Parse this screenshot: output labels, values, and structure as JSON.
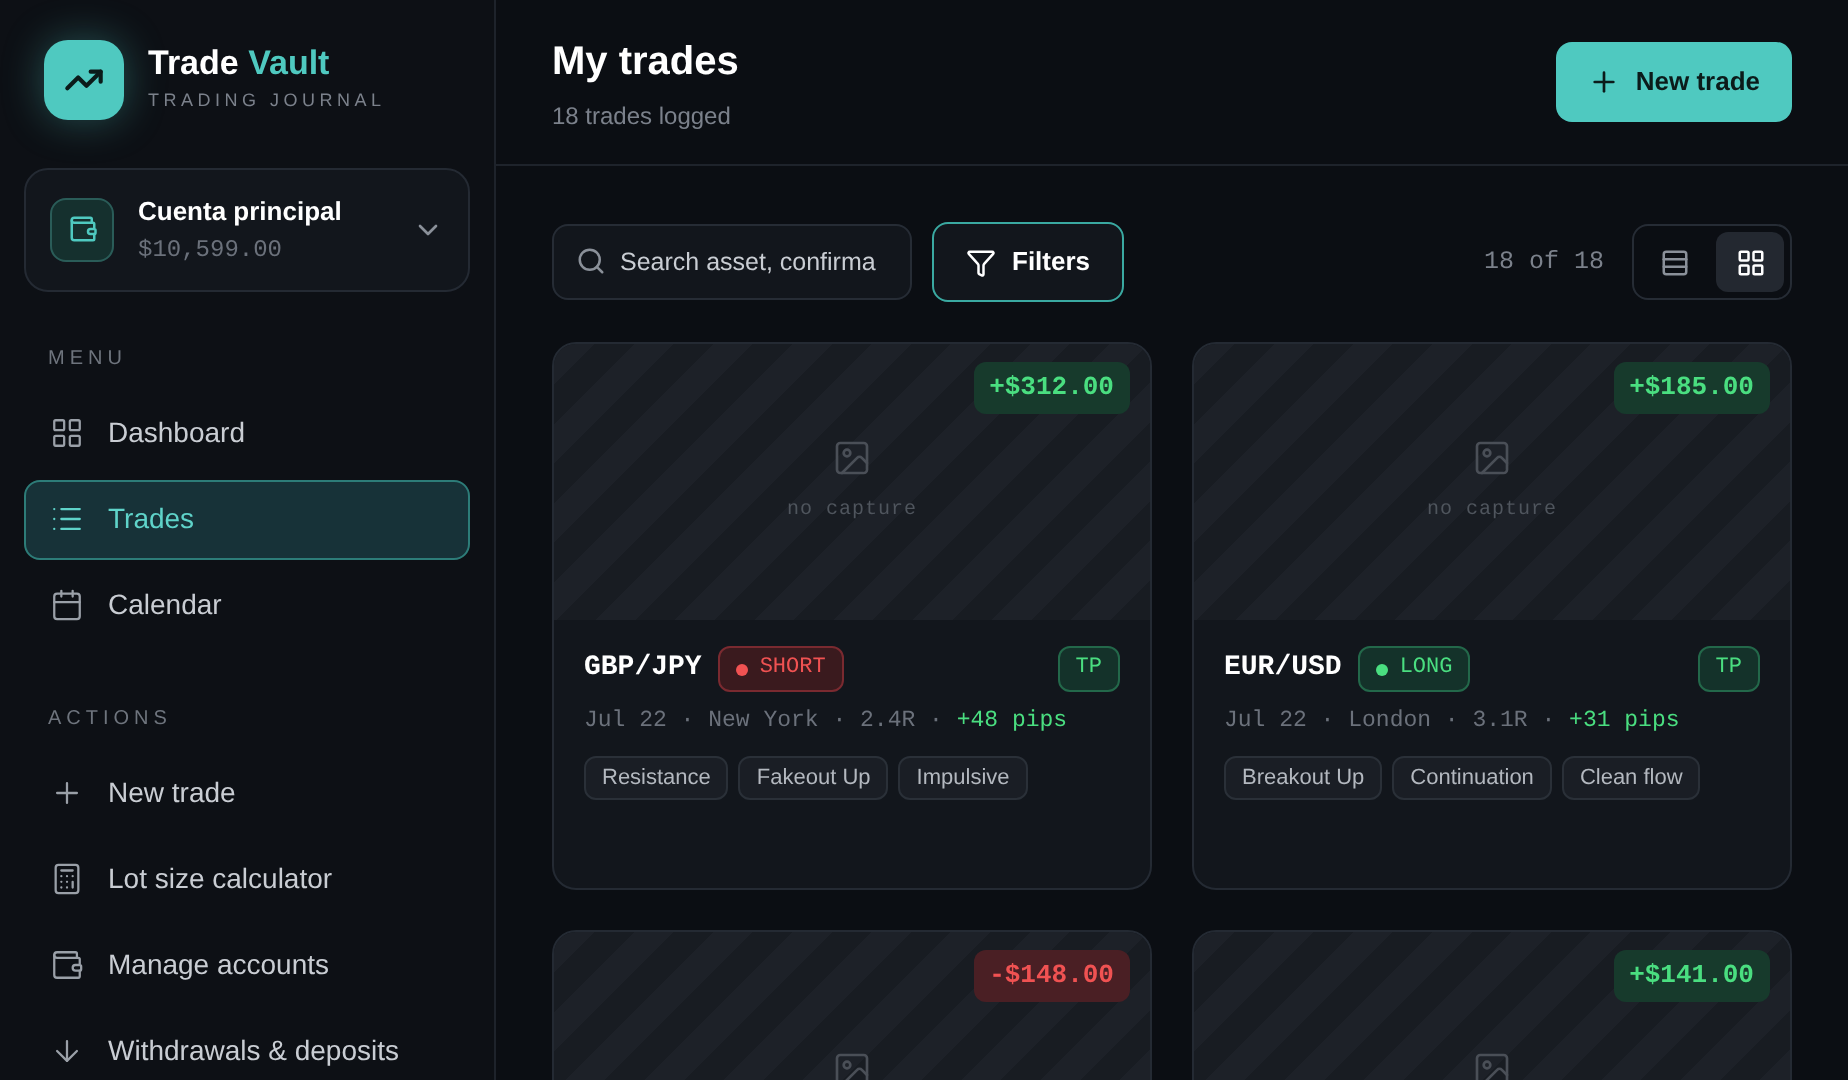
{
  "brand": {
    "name": "Trade ",
    "accent": "Vault",
    "tagline": "TRADING JOURNAL"
  },
  "account": {
    "name": "Cuenta principal",
    "balance": "$10,599.00"
  },
  "sections": [
    {
      "title": "MENU",
      "items": [
        {
          "label": "Dashboard",
          "kind": "dashboard",
          "selected": false
        },
        {
          "label": "Trades",
          "kind": "list",
          "selected": true
        },
        {
          "label": "Calendar",
          "kind": "calendar",
          "selected": false
        }
      ]
    },
    {
      "title": "ACTIONS",
      "items": [
        {
          "label": "New trade",
          "kind": "plus",
          "selected": false
        },
        {
          "label": "Lot size calculator",
          "kind": "calculator",
          "selected": false
        },
        {
          "label": "Manage accounts",
          "kind": "wallet",
          "selected": false
        },
        {
          "label": "Withdrawals & deposits",
          "kind": "arrow-down",
          "selected": false
        }
      ]
    }
  ],
  "header": {
    "title": "My trades",
    "subtitle": "18 trades logged",
    "action": "New trade"
  },
  "search": {
    "placeholder": "Search asset, confirma"
  },
  "filters": "Filters",
  "count": "18 of 18",
  "view_toggle": [
    {
      "kind": "list",
      "selected": false
    },
    {
      "kind": "grid",
      "selected": true
    }
  ],
  "trades": [
    {
      "pnl": "+$312.00",
      "kind": "gain",
      "empty_label": "no capture",
      "pair": "GBP/JPY",
      "side": {
        "label": "SHORT",
        "kind": "short"
      },
      "result": "TP",
      "meta": "Jul 22 · New York · 2.4R ·",
      "pips": "+48 pips",
      "tags": [
        "Resistance",
        "Fakeout Up",
        "Impulsive"
      ]
    },
    {
      "pnl": "+$185.00",
      "kind": "gain",
      "empty_label": "no capture",
      "pair": "EUR/USD",
      "side": {
        "label": "LONG",
        "kind": "long"
      },
      "result": "TP",
      "meta": "Jul 22 · London · 3.1R ·",
      "pips": "+31 pips",
      "tags": [
        "Breakout Up",
        "Continuation",
        "Clean flow"
      ]
    },
    {
      "pnl": "-$148.00",
      "kind": "loss"
    },
    {
      "pnl": "+$141.00",
      "kind": "gain"
    }
  ]
}
